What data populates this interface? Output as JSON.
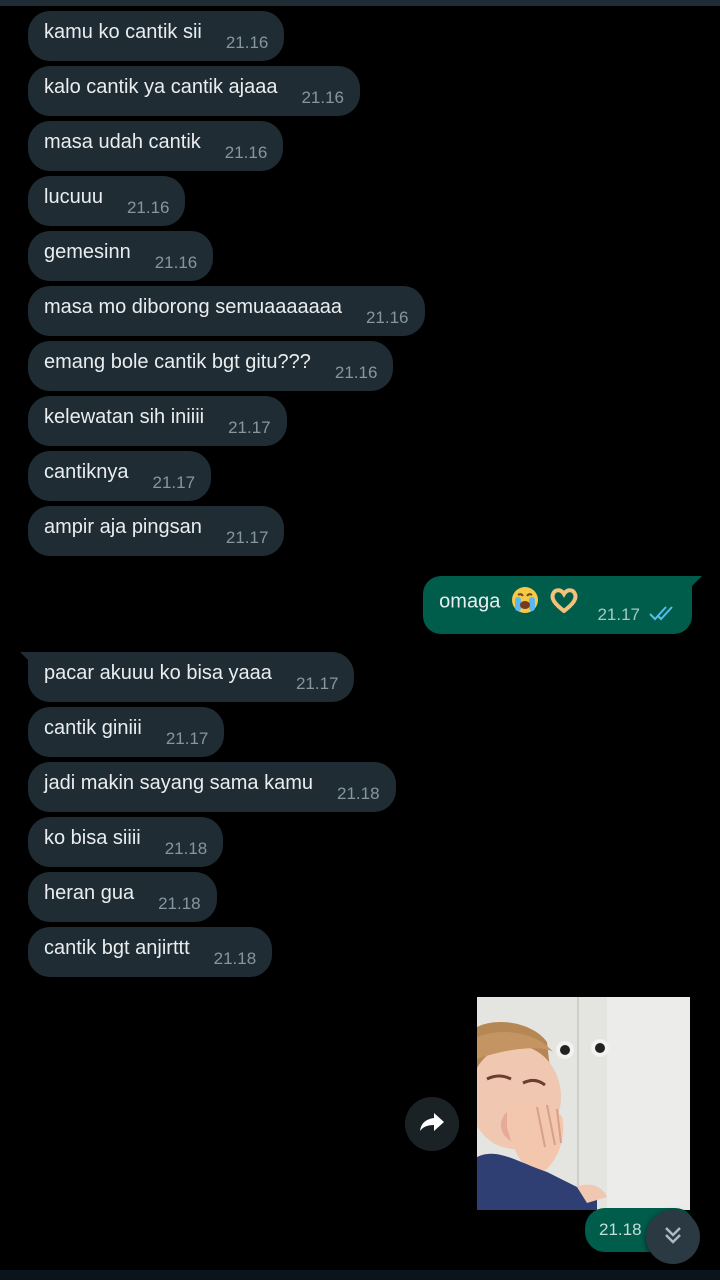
{
  "incoming_group_1": [
    {
      "text": "kamu ko cantik sii",
      "time": "21.16"
    },
    {
      "text": "kalo cantik ya cantik ajaaa",
      "time": "21.16"
    },
    {
      "text": "masa udah cantik",
      "time": "21.16"
    },
    {
      "text": "lucuuu",
      "time": "21.16"
    },
    {
      "text": "gemesinn",
      "time": "21.16"
    },
    {
      "text": "masa mo diborong semuaaaaaaa",
      "time": "21.16"
    },
    {
      "text": "emang bole cantik bgt gitu???",
      "time": "21.16"
    },
    {
      "text": "kelewatan sih iniiii",
      "time": "21.17"
    },
    {
      "text": "cantiknya",
      "time": "21.17"
    },
    {
      "text": "ampir aja pingsan",
      "time": "21.17"
    }
  ],
  "outgoing_message": {
    "text": "omaga",
    "time": "21.17",
    "status": "read",
    "emojis": [
      "loudly-crying-face",
      "heart-hands"
    ]
  },
  "incoming_group_2": [
    {
      "text": "pacar akuuu ko bisa yaaa",
      "time": "21.17"
    },
    {
      "text": "cantik giniii",
      "time": "21.17"
    },
    {
      "text": "jadi makin sayang sama kamu",
      "time": "21.18"
    },
    {
      "text": "ko bisa siiii",
      "time": "21.18"
    },
    {
      "text": "heran gua",
      "time": "21.18"
    },
    {
      "text": "cantik bgt anjirttt",
      "time": "21.18"
    }
  ],
  "outgoing_sticker": {
    "time": "21.18",
    "icon": "crying-child-sticker"
  },
  "controls": {
    "forward_icon": "forward-arrow-icon",
    "scroll_icon": "double-chevron-down-icon"
  },
  "colors": {
    "background": "#000000",
    "incoming_bubble": "#1f2c34",
    "outgoing_bubble": "#005c4b",
    "timestamp": "#8696a0",
    "read_ticks": "#53bdeb"
  }
}
